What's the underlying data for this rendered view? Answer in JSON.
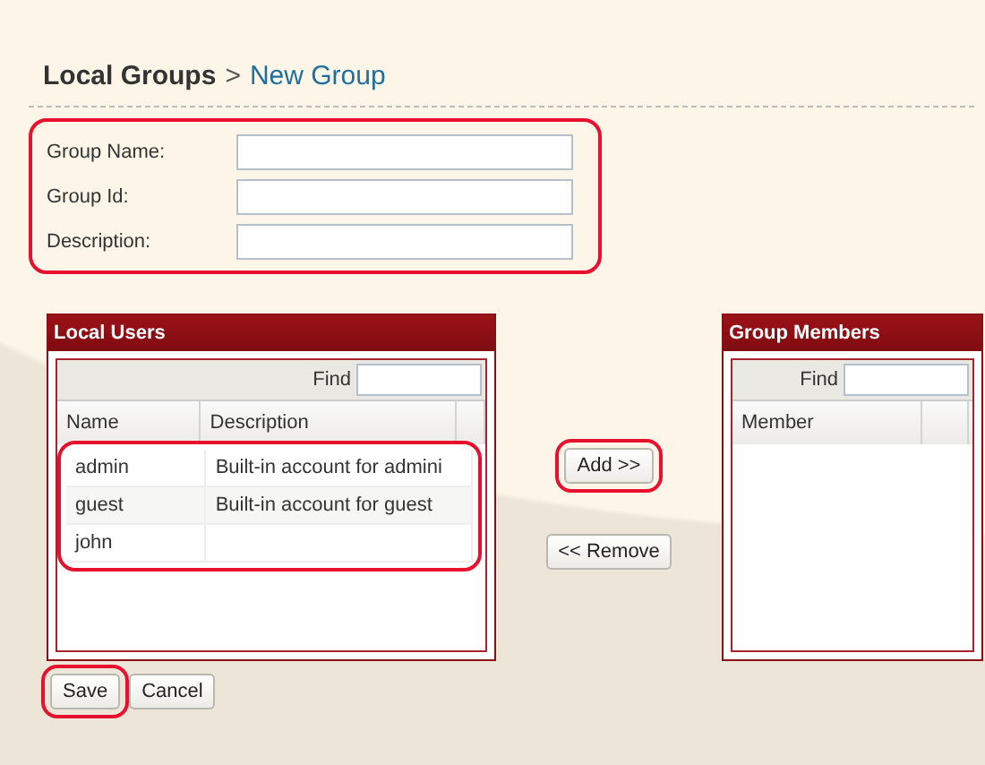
{
  "breadcrumb": {
    "parent": "Local Groups",
    "separator": ">",
    "current": "New Group"
  },
  "form": {
    "highlighted": true,
    "fields": [
      {
        "label": "Group Name:"
      },
      {
        "label": "Group Id:"
      },
      {
        "label": "Description:"
      }
    ]
  },
  "local_users": {
    "title": "Local Users",
    "find_label": "Find",
    "columns": [
      "Name",
      "Description"
    ],
    "rows_highlighted": true,
    "rows": [
      {
        "name": "admin",
        "description": "Built-in account for admini"
      },
      {
        "name": "guest",
        "description": "Built-in account for guest"
      },
      {
        "name": "john"
      }
    ]
  },
  "transfer_buttons": [
    {
      "label": "Add >>",
      "highlighted": true
    },
    {
      "label": "<< Remove",
      "highlighted": false
    }
  ],
  "group_members": {
    "title": "Group Members",
    "find_label": "Find",
    "columns": [
      "Member"
    ]
  },
  "actions": [
    {
      "label": "Save",
      "highlighted": true
    },
    {
      "label": "Cancel",
      "highlighted": false
    }
  ]
}
